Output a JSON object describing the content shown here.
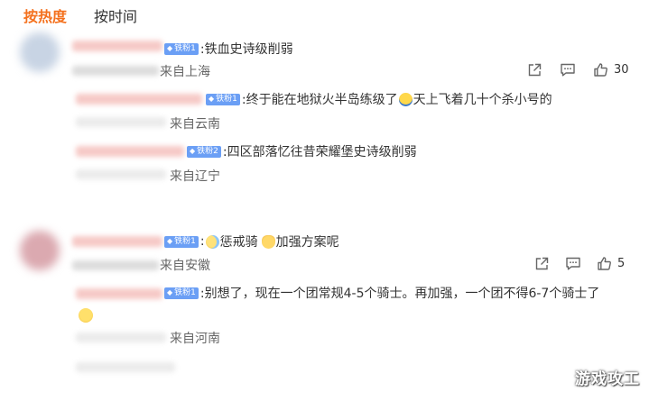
{
  "tabs": [
    {
      "label": "按热度",
      "active": true
    },
    {
      "label": "按时间",
      "active": false
    }
  ],
  "comments": [
    {
      "badge": "铁粉1",
      "text": ":铁血史诗级削弱",
      "location": "来自上海",
      "likes": "30",
      "replies": [
        {
          "badge": "铁粉1",
          "text_a": ":终于能在地狱火半岛练级了",
          "emoji": "laughing-emoji",
          "text_b": "天上飞着几十个杀小号的",
          "location": "来自云南"
        },
        {
          "badge": "铁粉2",
          "text_a": ":四区部落忆往昔荣耀堡史诗级削弱",
          "location": "来自辽宁"
        }
      ]
    },
    {
      "badge": "铁粉1",
      "text_pre": ":",
      "emoji1": "crying-emoji",
      "text_mid": "惩戒骑",
      "emoji2": "cat-emoji",
      "text_post": "加强方案呢",
      "location": "来自安徽",
      "likes": "5",
      "replies": [
        {
          "badge": "铁粉1",
          "text_a": ":别想了，现在一个团常规4-5个骑士。再加强，一个团不得6-7个骑士了",
          "emoji": "smile-emoji",
          "location": "来自河南"
        }
      ]
    }
  ],
  "watermark": "游戏攻工",
  "colors": {
    "accent": "#f4711e",
    "badge": "#6b9ff5",
    "icon": "#666666"
  },
  "icons": {
    "share": "share-icon",
    "comment": "comment-icon",
    "like": "thumbs-up-icon"
  }
}
